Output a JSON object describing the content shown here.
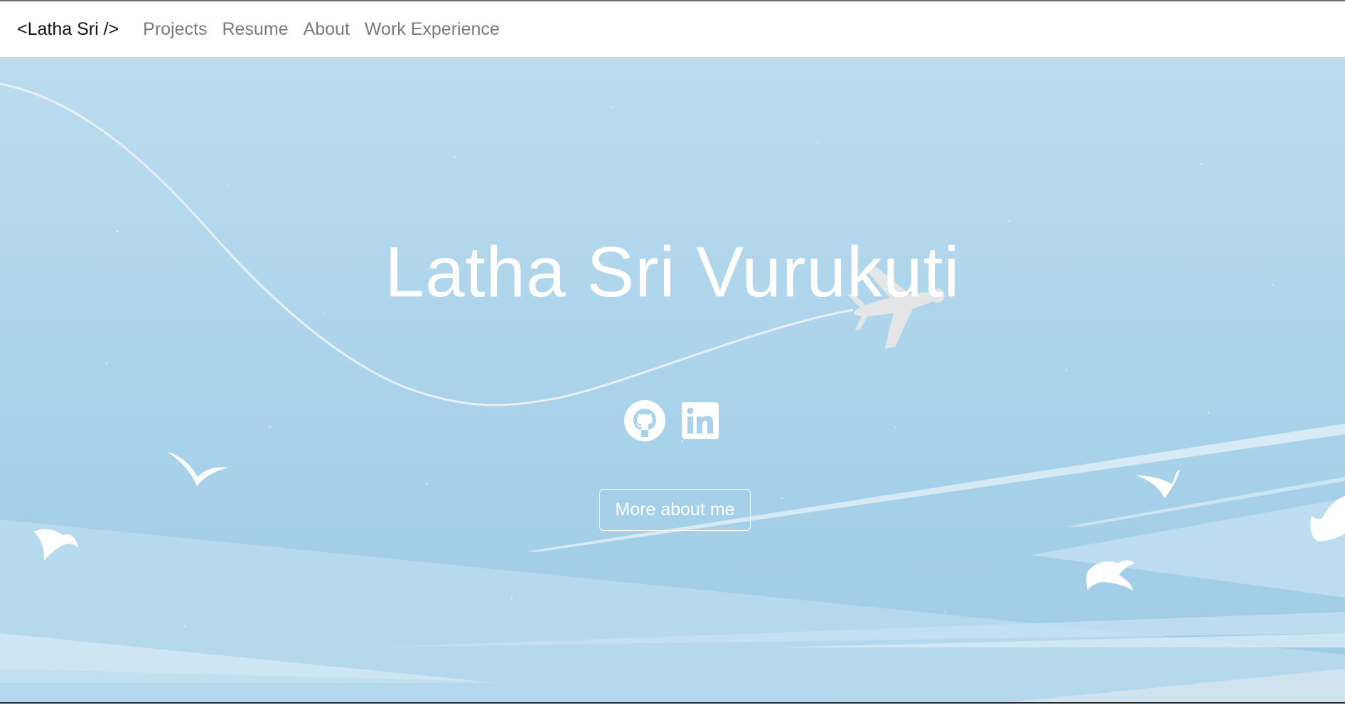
{
  "nav": {
    "brand": "<Latha Sri />",
    "links": [
      {
        "label": "Projects"
      },
      {
        "label": "Resume"
      },
      {
        "label": "About"
      },
      {
        "label": "Work Experience"
      }
    ]
  },
  "hero": {
    "title": "Latha Sri Vurukuti",
    "social": [
      {
        "icon": "github-icon"
      },
      {
        "icon": "linkedin-icon"
      }
    ],
    "cta_label": "More about me"
  },
  "colors": {
    "sky_top": "#bcdcee",
    "sky_bottom": "#9ecbe6",
    "accent": "#ffffff",
    "nav_link": "#7a7a7a"
  }
}
